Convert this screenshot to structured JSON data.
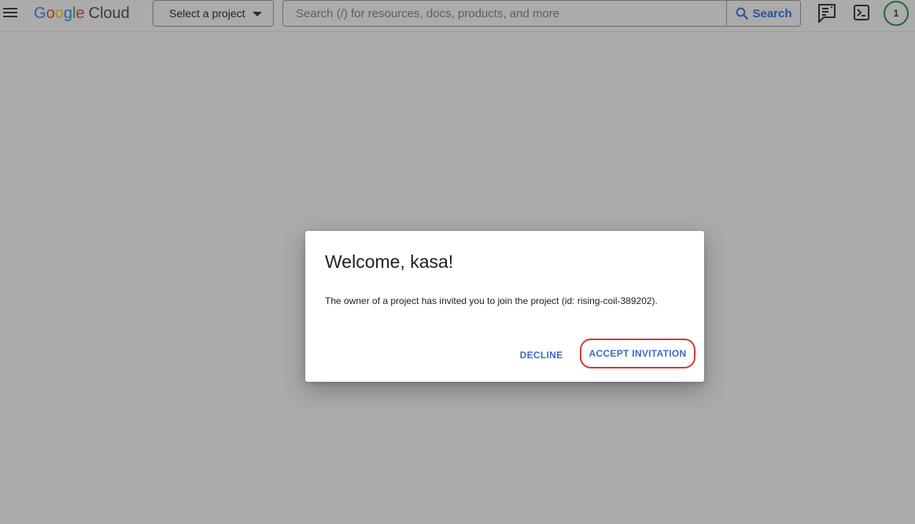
{
  "header": {
    "logo": {
      "g1": "G",
      "g2": "o",
      "g3": "o",
      "g4": "g",
      "g5": "l",
      "g6": "e",
      "cloud": "Cloud"
    },
    "project_select_label": "Select a project",
    "search": {
      "placeholder": "Search (/) for resources, docs, products, and more",
      "button_label": "Search"
    },
    "icons": [
      "menu-icon",
      "dropdown-caret-icon",
      "search-icon",
      "notes-icon",
      "terminal-icon"
    ],
    "avatar_label": "1"
  },
  "dialog": {
    "title": "Welcome, kasa!",
    "body": "The owner of a project has invited you to join the project (id: rising-coil-389202).",
    "decline_label": "DECLINE",
    "accept_label": "ACCEPT INVITATION"
  },
  "colors": {
    "overlay_bg": "#ababab",
    "accent_blue": "#3d69c8",
    "highlight_red": "#d23a3a",
    "avatar_ring": "#1f6b35"
  }
}
